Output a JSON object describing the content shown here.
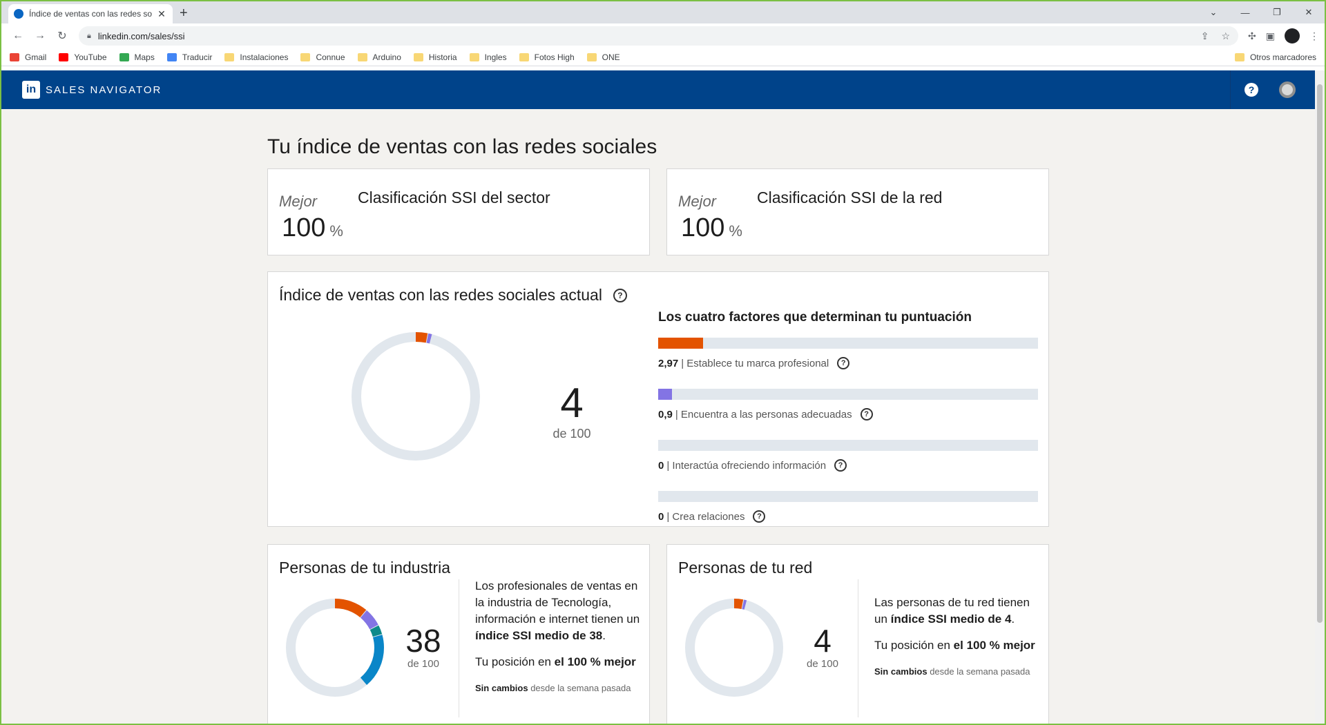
{
  "browser": {
    "tab_title": "Índice de ventas con las redes so",
    "url": "linkedin.com/sales/ssi",
    "bookmarks": [
      "Gmail",
      "YouTube",
      "Maps",
      "Traducir",
      "Instalaciones",
      "Connue",
      "Arduino",
      "Historia",
      "Ingles",
      "Fotos High",
      "ONE"
    ],
    "other_bookmarks": "Otros marcadores"
  },
  "header": {
    "logo": "in",
    "title": "SALES NAVIGATOR"
  },
  "page": {
    "title": "Tu índice de ventas con las redes sociales"
  },
  "rank_sector": {
    "best": "Mejor",
    "value": "100",
    "unit": "%",
    "label": "Clasificación SSI del sector"
  },
  "rank_network": {
    "best": "Mejor",
    "value": "100",
    "unit": "%",
    "label": "Clasificación SSI de la red"
  },
  "ssi": {
    "title": "Índice de ventas con las redes sociales actual",
    "score": "4",
    "of": "de 100",
    "factors_title": "Los cuatro factores que determinan tu puntuación",
    "factors": [
      {
        "value": "2,97",
        "label": "| Establece tu marca profesional",
        "fill": 0.1188,
        "color": "#e35300"
      },
      {
        "value": "0,9",
        "label": "| Encuentra a las personas adecuadas",
        "fill": 0.036,
        "color": "#8374e4"
      },
      {
        "value": "0",
        "label": "| Interactúa ofreciendo información",
        "fill": 0,
        "color": "#0d8a8a"
      },
      {
        "value": "0",
        "label": "| Crea relaciones",
        "fill": 0,
        "color": "#0a86c8"
      }
    ]
  },
  "industry": {
    "title": "Personas de tu industria",
    "score": "38",
    "of": "de 100",
    "desc_pre": "Los profesionales de ventas en la industria de Tecnología, información e internet tienen un ",
    "desc_bold": "índice SSI medio de 38",
    "desc_post": ".",
    "pos_pre": "Tu posición en ",
    "pos_bold": "el 100 % mejor",
    "change_bold": "Sin cambios",
    "change_rest": " desde la semana pasada"
  },
  "network": {
    "title": "Personas de tu red",
    "score": "4",
    "of": "de 100",
    "desc_pre": "Las personas de tu red tienen un ",
    "desc_bold": "índice SSI medio de 4",
    "desc_post": ".",
    "pos_pre": "Tu posición en ",
    "pos_bold": "el 100 % mejor",
    "change_bold": "Sin cambios",
    "change_rest": " desde la semana pasada"
  },
  "colors": {
    "brand": "#00438a",
    "orange": "#e35300",
    "purple": "#8374e4",
    "teal": "#0d8a8a",
    "blue": "#0a86c8",
    "track": "#e1e7ed"
  },
  "donuts": {
    "ssi": [
      {
        "value": 2.97,
        "color": "#e35300"
      },
      {
        "value": 0.9,
        "color": "#8374e4"
      }
    ],
    "industry": [
      {
        "value": 11,
        "color": "#e35300"
      },
      {
        "value": 6,
        "color": "#8374e4"
      },
      {
        "value": 3,
        "color": "#0d8a8a"
      },
      {
        "value": 18,
        "color": "#0a86c8"
      }
    ],
    "network": [
      {
        "value": 2.97,
        "color": "#e35300"
      },
      {
        "value": 0.9,
        "color": "#8374e4"
      }
    ]
  }
}
